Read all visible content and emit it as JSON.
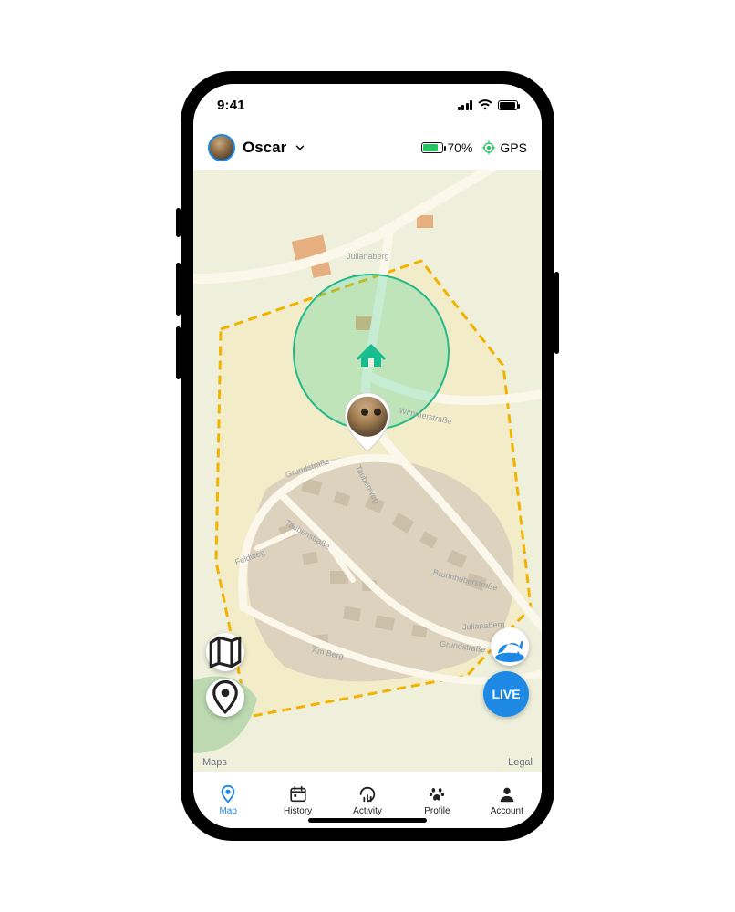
{
  "status_bar": {
    "time": "9:41"
  },
  "header": {
    "pet_name": "Oscar",
    "battery_pct": "70%",
    "gps_label": "GPS"
  },
  "map": {
    "street_julianaberg": "Julianaberg",
    "street_julianaberg2": "Julianaberg",
    "street_wimmerstrasse": "Wimmerstraße",
    "street_taubenweg": "Taubenweg",
    "street_taubenstrasse": "Taubenstraße",
    "street_grundstrasse": "Grundstraße",
    "street_grundstrasse2": "Grundstraße",
    "street_feldweg": "Feldweg",
    "street_amberg": "Am Berg",
    "street_brunnhuber": "Brunnhuberstraße",
    "attr_left": "Maps",
    "attr_right": "Legal"
  },
  "fab": {
    "live_label": "LIVE"
  },
  "tabs": {
    "map": "Map",
    "history": "History",
    "activity": "Activity",
    "profile": "Profile",
    "account": "Account"
  }
}
